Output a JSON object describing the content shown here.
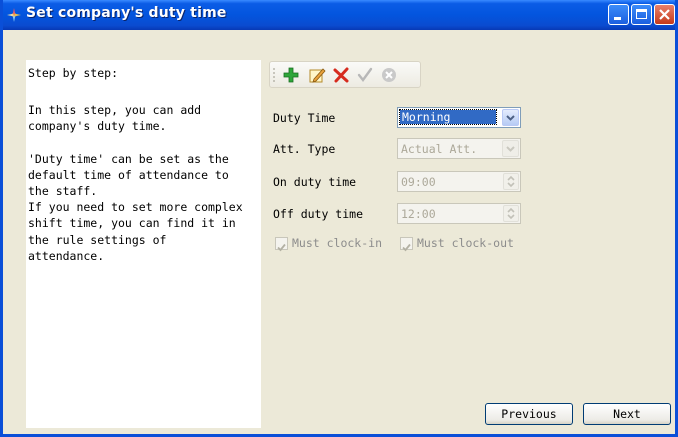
{
  "window": {
    "title": "Set company's duty time"
  },
  "left_panel": {
    "step_title": "Step by step:",
    "description": "In this step, you can add\ncompany's duty time.\n\n'Duty time' can be set as the\ndefault time of attendance to\nthe staff.\nIf you need to set more complex\nshift time, you can find it in\nthe rule settings of\nattendance."
  },
  "toolbar": {
    "add_icon": "plus-icon",
    "edit_icon": "edit-icon",
    "delete_icon": "delete-icon",
    "confirm_icon": "check-icon",
    "cancel_icon": "cancel-icon"
  },
  "form": {
    "duty_time_label": "Duty Time",
    "duty_time_value": "Morning",
    "att_type_label": "Att. Type",
    "att_type_value": "Actual Att.",
    "on_duty_label": "On duty time",
    "on_duty_value": "09:00",
    "off_duty_label": "Off duty time",
    "off_duty_value": "12:00",
    "must_clock_in_label": "Must clock-in",
    "must_clock_in_checked": true,
    "must_clock_out_label": "Must clock-out",
    "must_clock_out_checked": true
  },
  "buttons": {
    "previous_label": "Previous",
    "next_label": "Next"
  },
  "colors": {
    "title_bar": "#0355DE",
    "window_bg": "#ECE9D8",
    "selection": "#316AC5"
  }
}
